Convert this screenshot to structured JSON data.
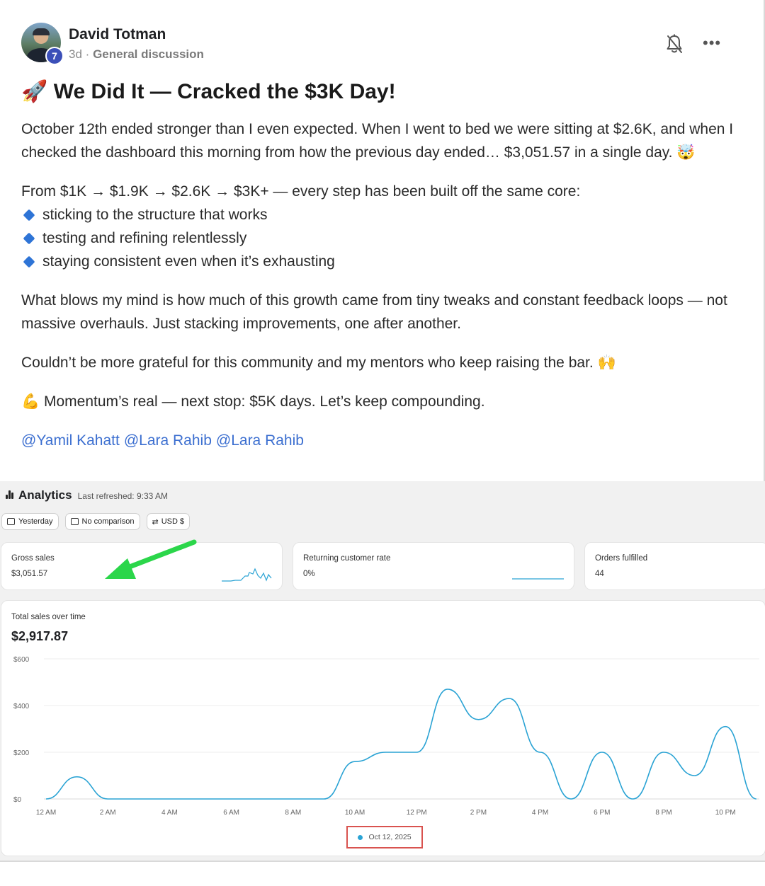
{
  "post": {
    "author": "David Totman",
    "level": "7",
    "time": "3d",
    "separator": "·",
    "category": "General discussion",
    "title": "🚀 We Did It — Cracked the $3K Day!",
    "para1": "October 12th ended stronger than I even expected. When I went to bed we were sitting at $2.6K, and when I checked the dashboard this morning from how the previous day ended… $3,051.57 in a single day. 🤯",
    "para2": "From $1K → $1.9K → $2.6K → $3K+ — every step has been built off the same core:",
    "bullets": [
      "sticking to the structure that works",
      "testing and refining relentlessly",
      "staying consistent even when it’s exhausting"
    ],
    "para3": "What blows my mind is how much of this growth came from tiny tweaks and constant feedback loops — not massive overhauls. Just stacking improvements, one after another.",
    "para4": "Couldn’t be more grateful for this community and my mentors who keep raising the bar. 🙌",
    "para5": "💪 Momentum’s real — next stop: $5K days. Let’s keep compounding.",
    "mentions": [
      "@Yamil Kahatt",
      "@Lara Rahib",
      "@Lara Rahib"
    ],
    "icons": {
      "notifications": "bell-off-icon",
      "more": "more-options-icon"
    }
  },
  "analytics": {
    "title": "Analytics",
    "refreshed": "Last refreshed: 9:33 AM",
    "chips": [
      "Yesterday",
      "No comparison",
      "USD $"
    ],
    "cards": {
      "gross_label": "Gross sales",
      "gross_value": "$3,051.57",
      "returning_label": "Returning customer rate",
      "returning_value": "0%",
      "orders_label": "Orders fulfilled",
      "orders_value": "44"
    },
    "total_label": "Total sales over time",
    "total_value": "$2,917.87",
    "legend": "Oct 12, 2025"
  },
  "chart_data": {
    "type": "line",
    "title": "Total sales over time",
    "x": [
      "12 AM",
      "1 AM",
      "2 AM",
      "3 AM",
      "4 AM",
      "5 AM",
      "6 AM",
      "7 AM",
      "8 AM",
      "9 AM",
      "10 AM",
      "11 AM",
      "12 PM",
      "1 PM",
      "2 PM",
      "3 PM",
      "4 PM",
      "5 PM",
      "6 PM",
      "7 PM",
      "8 PM",
      "9 PM",
      "10 PM",
      "11 PM"
    ],
    "x_tick_labels": [
      "12 AM",
      "2 AM",
      "4 AM",
      "6 AM",
      "8 AM",
      "10 AM",
      "12 PM",
      "2 PM",
      "4 PM",
      "6 PM",
      "8 PM",
      "10 PM"
    ],
    "series": [
      {
        "name": "Oct 12, 2025",
        "color": "#2aa3d4",
        "values": [
          0,
          95,
          0,
          0,
          0,
          0,
          0,
          0,
          0,
          0,
          160,
          200,
          200,
          470,
          340,
          430,
          200,
          0,
          200,
          0,
          200,
          100,
          310,
          0
        ]
      }
    ],
    "y_ticks": [
      "$0",
      "$200",
      "$400",
      "$600"
    ],
    "ylim": [
      0,
      600
    ],
    "grid": true
  }
}
